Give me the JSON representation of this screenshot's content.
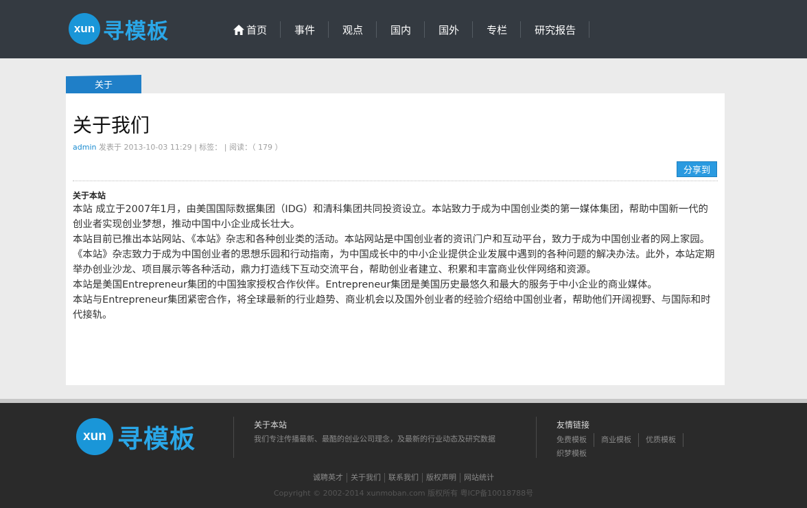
{
  "header": {
    "logo_mark": "xun",
    "logo_text": "寻模板",
    "nav": [
      {
        "label": "首页",
        "icon": "home-icon"
      },
      {
        "label": "事件"
      },
      {
        "label": "观点"
      },
      {
        "label": "国内"
      },
      {
        "label": "国外"
      },
      {
        "label": "专栏"
      },
      {
        "label": "研究报告"
      }
    ]
  },
  "tab": {
    "label": "关于"
  },
  "article": {
    "title": "关于我们",
    "author": "admin",
    "meta_rest": " 发表于 2013-10-03 11:29 | 标签： | 阅读：（ 179 ）",
    "share_label": "分享到",
    "body_heading": "关于本站",
    "paragraphs": [
      "本站 成立于2007年1月，由美国国际数据集团（IDG）和清科集团共同投资设立。本站致力于成为中国创业类的第一媒体集团，帮助中国新一代的创业者实现创业梦想，推动中国中小企业成长壮大。",
      "本站目前已推出本站网站、《本站》杂志和各种创业类的活动。本站网站是中国创业者的资讯门户和互动平台，致力于成为中国创业者的网上家园。《本站》杂志致力于成为中国创业者的思想乐园和行动指南，为中国成长中的中小企业提供企业发展中遇到的各种问题的解决办法。此外，本站定期举办创业沙龙、项目展示等各种活动，鼎力打造线下互动交流平台，帮助创业者建立、积累和丰富商业伙伴网络和资源。",
      "本站是美国Entrepreneur集团的中国独家授权合作伙伴。Entrepreneur集团是美国历史最悠久和最大的服务于中小企业的商业媒体。",
      "本站与Entrepreneur集团紧密合作，将全球最新的行业趋势、商业机会以及国外创业者的经验介绍给中国创业者，帮助他们开阔视野、与国际和时代接轨。"
    ]
  },
  "footer": {
    "logo_mark": "xun",
    "logo_text": "寻模板",
    "about_heading": "关于本站",
    "about_text": "我们专注传播最新、最酷的创业公司理念，及最新的行业动态及研究数据",
    "links_heading": "友情链接",
    "links": [
      "免费模板",
      "商业模板",
      "优质模板",
      "织梦模板"
    ],
    "bottom_links": [
      "诚聘英才",
      "关于我们",
      "联系我们",
      "版权声明",
      "网站统计"
    ],
    "copyright": "Copyright © 2002-2014 xunmoban.com 版权所有 粤ICP备10018788号"
  }
}
